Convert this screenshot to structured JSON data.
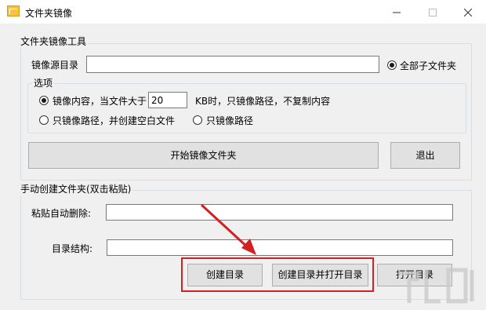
{
  "window": {
    "title": "文件夹镜像",
    "minimize_glyph": "—",
    "close_glyph": "✕"
  },
  "mirror_tool": {
    "group_title": "文件夹镜像工具",
    "source_label": "镜像源目录",
    "source_value": "",
    "all_subfolders_label": "全部子文件夹",
    "options_title": "选项",
    "option1_prefix": "镜像内容，当文件大于",
    "size_value": "20",
    "option1_suffix": "KB时，只镜像路径，不复制内容",
    "option2_label": "只镜像路径，并创建空白文件",
    "option3_label": "只镜像路径",
    "start_button": "开始镜像文件夹",
    "exit_button": "退出"
  },
  "manual_create": {
    "group_title": "手动创建文件夹(双击粘贴)",
    "paste_label": "粘贴自动删除:",
    "paste_value": "",
    "structure_label": "目录结构:",
    "structure_value": "",
    "create_button": "创建目录",
    "create_open_button": "创建目录并打开目录",
    "open_button": "打开目录"
  },
  "annotation": {
    "highlight_color": "#d42020",
    "arrow_color": "#d42020"
  }
}
